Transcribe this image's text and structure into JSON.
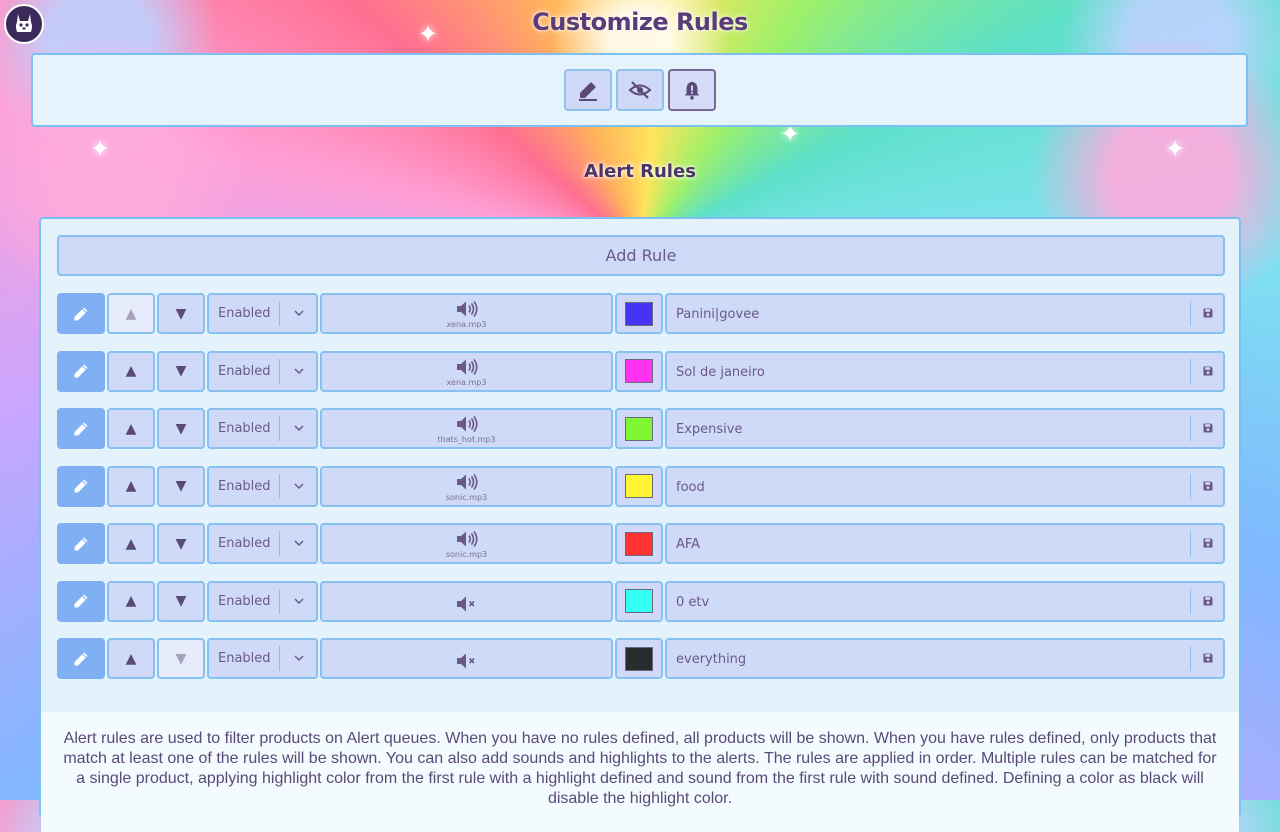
{
  "header": {
    "title": "Customize Rules"
  },
  "toolbar": {
    "buttons": [
      {
        "icon": "pencil-icon"
      },
      {
        "icon": "eye-slash-icon"
      },
      {
        "icon": "bell-alert-icon",
        "active": true
      }
    ]
  },
  "section": {
    "title": "Alert Rules"
  },
  "add_rule_label": "Add Rule",
  "rules": [
    {
      "status": "Enabled",
      "sound": "xena.mp3",
      "color": "#4534f5",
      "keyword": "Panini|govee",
      "up_disabled": true,
      "down_disabled": false
    },
    {
      "status": "Enabled",
      "sound": "xena.mp3",
      "color": "#ff33f0",
      "keyword": "Sol de janeiro",
      "up_disabled": false,
      "down_disabled": false
    },
    {
      "status": "Enabled",
      "sound": "thats_hot.mp3",
      "color": "#7ff533",
      "keyword": "Expensive",
      "up_disabled": false,
      "down_disabled": false
    },
    {
      "status": "Enabled",
      "sound": "sonic.mp3",
      "color": "#fff533",
      "keyword": "food",
      "up_disabled": false,
      "down_disabled": false
    },
    {
      "status": "Enabled",
      "sound": "sonic.mp3",
      "color": "#ff3333",
      "keyword": "AFA",
      "up_disabled": false,
      "down_disabled": false
    },
    {
      "status": "Enabled",
      "sound": "",
      "color": "#33fff5",
      "keyword": "0 etv",
      "up_disabled": false,
      "down_disabled": false
    },
    {
      "status": "Enabled",
      "sound": "",
      "color": "#292b2f",
      "keyword": "everything",
      "up_disabled": false,
      "down_disabled": true
    }
  ],
  "help_text": "Alert rules are used to filter products on Alert queues. When you have no rules defined, all products will be shown. When you have rules defined, only products that match at least one of the rules will be shown. You can also add sounds and highlights to the alerts. The rules are applied in order. Multiple rules can be matched for a single product, applying highlight color from the first rule with a highlight defined and sound from the first rule with sound defined. Defining a color as black will disable the highlight color."
}
